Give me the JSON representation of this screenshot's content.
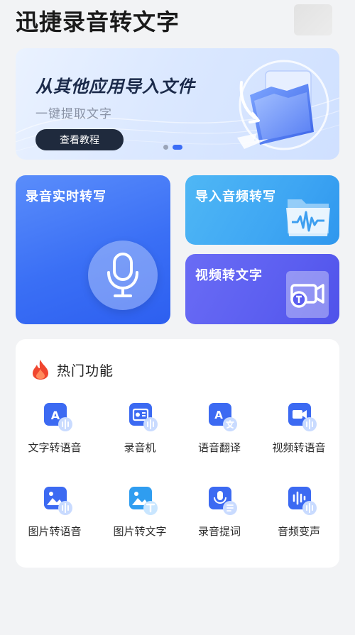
{
  "app": {
    "title": "迅捷录音转文字"
  },
  "banner": {
    "title": "从其他应用导入文件",
    "subtitle": "一键提取文字",
    "button_label": "查看教程",
    "page_count": 2,
    "active_page": 2
  },
  "cards": {
    "record": {
      "label": "录音实时转写",
      "icon": "microphone-icon"
    },
    "import": {
      "label": "导入音频转写",
      "icon": "audio-folder-icon"
    },
    "video": {
      "label": "视频转文字",
      "icon": "video-text-icon"
    }
  },
  "hot": {
    "title": "热门功能",
    "icon": "flame-icon",
    "items": [
      {
        "label": "文字转语音",
        "icon": "text-to-speech-icon"
      },
      {
        "label": "录音机",
        "icon": "recorder-icon"
      },
      {
        "label": "语音翻译",
        "icon": "translate-icon"
      },
      {
        "label": "视频转语音",
        "icon": "video-to-audio-icon"
      },
      {
        "label": "图片转语音",
        "icon": "image-to-audio-icon"
      },
      {
        "label": "图片转文字",
        "icon": "image-to-text-icon"
      },
      {
        "label": "录音提词",
        "icon": "teleprompter-icon"
      },
      {
        "label": "音频变声",
        "icon": "voice-changer-icon"
      }
    ]
  },
  "colors": {
    "accent": "#3b6df6",
    "record_card": "#3a6ff5",
    "import_card": "#3ea6f3",
    "video_card": "#5b5ef0"
  }
}
